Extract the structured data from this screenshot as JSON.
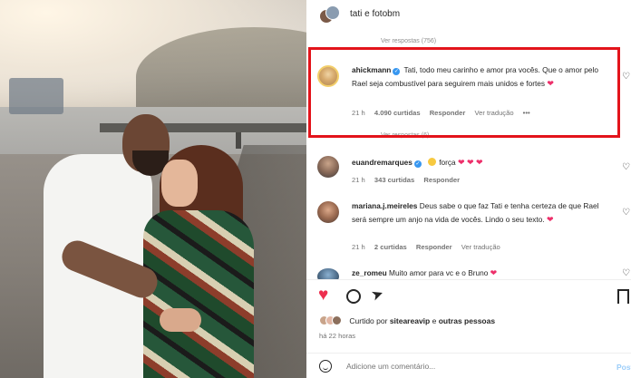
{
  "header": {
    "title": "tati e fotobm"
  },
  "comments": [
    {
      "id": "ahickmann",
      "username": "ahickmann",
      "verified": true,
      "text": "Tati, todo meu carinho e amor pra vocês. Que o amor pelo Rael seja combustível para seguirem mais unidos e fortes",
      "emoji": "❤",
      "time": "21 h",
      "likes": "4.090 curtidas",
      "reply": "Responder",
      "translate": "Ver tradução",
      "more": "•••",
      "view_replies": "Ver respostas (6)"
    },
    {
      "id": "euandremarques",
      "username": "euandremarques",
      "verified": true,
      "text": "força",
      "emoji": "❤ ❤ ❤",
      "time": "21 h",
      "likes": "343 curtidas",
      "reply": "Responder"
    },
    {
      "id": "mariana",
      "username": "mariana.j.meireles",
      "verified": false,
      "text": "Deus sabe o que faz Tati e tenha certeza de que Rael será sempre um anjo na vida de vocês. Lindo o seu texto.",
      "emoji": "❤",
      "time": "21 h",
      "likes": "2 curtidas",
      "reply": "Responder",
      "translate": "Ver tradução"
    },
    {
      "id": "ze",
      "username": "ze_romeu",
      "verified": false,
      "text": "Muito amor para vc e o Bruno",
      "emoji": "❤"
    }
  ],
  "scroll_fade_text": "Ver respostas (756)",
  "actions": {
    "like_icon": "heart-filled-icon",
    "comment_icon": "comment-icon",
    "share_icon": "share-icon",
    "save_icon": "bookmark-icon"
  },
  "likes_summary": {
    "prefix": "Curtido por",
    "user": "siteareavip",
    "joiner": "e",
    "others": "outras pessoas"
  },
  "time_ago": "há 22 horas",
  "composer": {
    "placeholder": "Adicione um comentário...",
    "post_label": "Postar"
  },
  "colors": {
    "accent_heart": "#ed2f4f",
    "verified": "#3897f0",
    "highlight_box": "#e3141b",
    "post_button": "#9bcdf9"
  }
}
